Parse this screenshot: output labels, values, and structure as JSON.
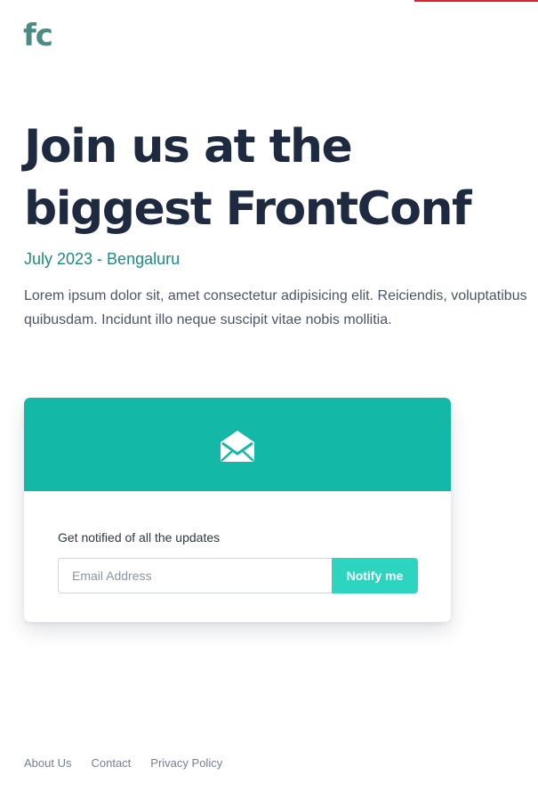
{
  "brand": {
    "logo_text": "fc",
    "accent_color": "#d9232e"
  },
  "hero": {
    "title": "Join us at the biggest FrontConf",
    "event_meta": "July 2023 - Bengaluru",
    "description": "Lorem ipsum dolor sit, amet consectetur adipisicing elit. Reiciendis, voluptatibus quibusdam. Incidunt illo neque suscipit vitae nobis mollitia."
  },
  "signup_card": {
    "header_icon": "envelope-open-icon",
    "header_color": "#14b8a6",
    "label": "Get notified of all the updates",
    "email_placeholder": "Email Address",
    "email_value": "",
    "button_label": "Notify me",
    "button_color": "#2dd4bf"
  },
  "footer": {
    "links": [
      {
        "label": "About Us"
      },
      {
        "label": "Contact"
      },
      {
        "label": "Privacy Policy"
      }
    ]
  }
}
